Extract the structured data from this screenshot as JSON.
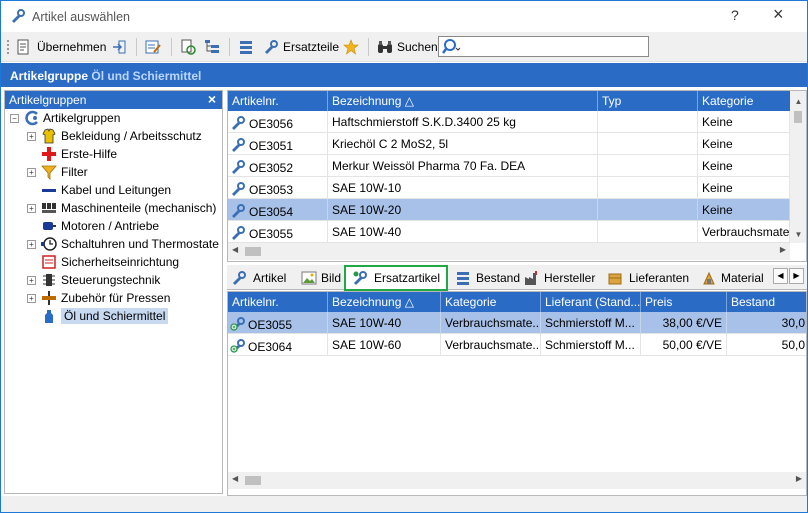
{
  "window": {
    "title": "Artikel auswählen",
    "help": "?",
    "close": "×"
  },
  "toolbar": {
    "accept_label": "Übernehmen",
    "spare_parts_label": "Ersatzteile",
    "search_label": "Suchen"
  },
  "banner": {
    "prefix": "Artikelgruppe",
    "group": "Öl und Schiermittel"
  },
  "tree": {
    "title": "Artikelgruppen",
    "close": "×",
    "root": "Artikelgruppen",
    "items": [
      {
        "label": "Bekleidung / Arbeitsschutz",
        "icon": "clothing-icon",
        "expandable": true
      },
      {
        "label": "Erste-Hilfe",
        "icon": "first-aid-icon",
        "expandable": false
      },
      {
        "label": "Filter",
        "icon": "filter-icon",
        "expandable": true
      },
      {
        "label": "Kabel und Leitungen",
        "icon": "cable-icon",
        "expandable": false
      },
      {
        "label": "Maschinenteile (mechanisch)",
        "icon": "machine-parts-icon",
        "expandable": true
      },
      {
        "label": "Motoren / Antriebe",
        "icon": "motor-icon",
        "expandable": false
      },
      {
        "label": "Schaltuhren und Thermostate",
        "icon": "timer-icon",
        "expandable": true
      },
      {
        "label": "Sicherheitseinrichtung",
        "icon": "safety-icon",
        "expandable": false
      },
      {
        "label": "Steuerungstechnik",
        "icon": "control-icon",
        "expandable": true
      },
      {
        "label": "Zubehör für Pressen",
        "icon": "press-accessory-icon",
        "expandable": true
      },
      {
        "label": "Öl und Schiermittel",
        "icon": "oil-icon",
        "expandable": false,
        "selected": true
      }
    ]
  },
  "articles": {
    "columns": [
      "Artikelnr.",
      "Bezeichnung",
      "Typ",
      "Kategorie"
    ],
    "sort_indicator": "△",
    "rows": [
      {
        "nr": "OE3056",
        "name": "Haftschmierstoff S.K.D.3400 25 kg",
        "typ": "",
        "kat": "Keine"
      },
      {
        "nr": "OE3051",
        "name": "Kriechöl C 2 MoS2, 5l",
        "typ": "",
        "kat": "Keine"
      },
      {
        "nr": "OE3052",
        "name": "Merkur Weissöl Pharma 70 Fa. DEA",
        "typ": "",
        "kat": "Keine"
      },
      {
        "nr": "OE3053",
        "name": "SAE 10W-10",
        "typ": "",
        "kat": "Keine"
      },
      {
        "nr": "OE3054",
        "name": "SAE 10W-20",
        "typ": "",
        "kat": "Keine",
        "selected": true
      },
      {
        "nr": "OE3055",
        "name": "SAE 10W-40",
        "typ": "",
        "kat": "Verbrauchsmate..."
      }
    ]
  },
  "tabs": [
    {
      "label": "Artikel",
      "icon": "article-icon"
    },
    {
      "label": "Bild",
      "icon": "image-icon"
    },
    {
      "label": "Ersatzartikel",
      "icon": "spare-article-icon",
      "active": true
    },
    {
      "label": "Bestand",
      "icon": "stock-icon"
    },
    {
      "label": "Hersteller",
      "icon": "manufacturer-icon"
    },
    {
      "label": "Lieferanten",
      "icon": "supplier-icon"
    },
    {
      "label": "Material",
      "icon": "material-icon"
    }
  ],
  "spares": {
    "columns": [
      "Artikelnr.",
      "Bezeichnung",
      "Kategorie",
      "Lieferant (Stand...",
      "Preis",
      "Bestand"
    ],
    "sort_indicator": "△",
    "rows": [
      {
        "nr": "OE3055",
        "name": "SAE 10W-40",
        "kat": "Verbrauchsmate...",
        "lief": "Schmierstoff M...",
        "preis": "38,00 €/VE",
        "bestand": "30,0",
        "selected": true
      },
      {
        "nr": "OE3064",
        "name": "SAE 10W-60",
        "kat": "Verbrauchsmate...",
        "lief": "Schmierstoff M...",
        "preis": "50,00 €/VE",
        "bestand": "50,0"
      }
    ]
  },
  "colors": {
    "accent": "#2a6cc5",
    "selection": "#a8c1e8",
    "active_tab_border": "#22a746"
  }
}
